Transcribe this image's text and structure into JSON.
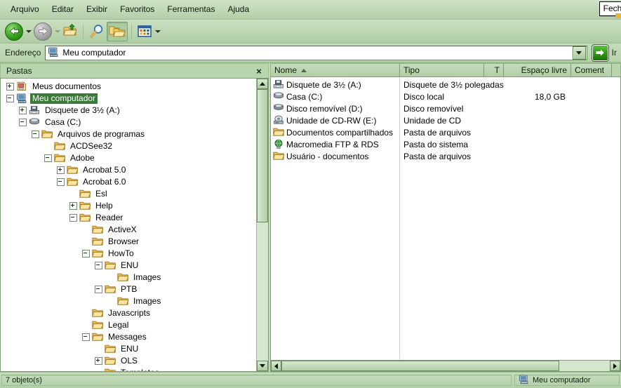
{
  "window": {
    "tooltip": "Fechar"
  },
  "menu": {
    "items": [
      {
        "label": "Arquivo"
      },
      {
        "label": "Editar"
      },
      {
        "label": "Exibir"
      },
      {
        "label": "Favoritos"
      },
      {
        "label": "Ferramentas"
      },
      {
        "label": "Ajuda"
      }
    ]
  },
  "toolbar": {
    "back": "Voltar",
    "forward": "Avançar",
    "up": "Acima",
    "search": "Pesquisar",
    "folders": "Pastas",
    "views": "Modos de exibição"
  },
  "address": {
    "label": "Endereço",
    "value": "Meu computador",
    "go_label": "Ir"
  },
  "tree": {
    "header": "Pastas",
    "close_label": "×",
    "items": [
      {
        "label": "Meus documentos",
        "indent": 0,
        "toggle": "plus",
        "icon": "my-documents-icon",
        "selected": false
      },
      {
        "label": "Meu computador",
        "indent": 0,
        "toggle": "minus",
        "icon": "my-computer-icon",
        "selected": true
      },
      {
        "label": "Disquete de 3½ (A:)",
        "indent": 1,
        "toggle": "plus",
        "icon": "floppy-icon",
        "selected": false
      },
      {
        "label": "Casa (C:)",
        "indent": 1,
        "toggle": "minus",
        "icon": "harddisk-icon",
        "selected": false
      },
      {
        "label": "Arquivos de programas",
        "indent": 2,
        "toggle": "minus",
        "icon": "folder-icon",
        "selected": false
      },
      {
        "label": "ACDSee32",
        "indent": 3,
        "toggle": "none",
        "icon": "folder-icon",
        "selected": false
      },
      {
        "label": "Adobe",
        "indent": 3,
        "toggle": "minus",
        "icon": "folder-icon",
        "selected": false
      },
      {
        "label": "Acrobat 5.0",
        "indent": 4,
        "toggle": "plus",
        "icon": "folder-icon",
        "selected": false
      },
      {
        "label": "Acrobat 6.0",
        "indent": 4,
        "toggle": "minus",
        "icon": "folder-icon",
        "selected": false
      },
      {
        "label": "Esl",
        "indent": 5,
        "toggle": "none",
        "icon": "folder-icon",
        "selected": false
      },
      {
        "label": "Help",
        "indent": 5,
        "toggle": "plus",
        "icon": "folder-icon",
        "selected": false
      },
      {
        "label": "Reader",
        "indent": 5,
        "toggle": "minus",
        "icon": "folder-icon",
        "selected": false
      },
      {
        "label": "ActiveX",
        "indent": 6,
        "toggle": "none",
        "icon": "folder-icon",
        "selected": false
      },
      {
        "label": "Browser",
        "indent": 6,
        "toggle": "none",
        "icon": "folder-icon",
        "selected": false
      },
      {
        "label": "HowTo",
        "indent": 6,
        "toggle": "minus",
        "icon": "folder-icon",
        "selected": false
      },
      {
        "label": "ENU",
        "indent": 7,
        "toggle": "minus",
        "icon": "folder-icon",
        "selected": false
      },
      {
        "label": "Images",
        "indent": 8,
        "toggle": "none",
        "icon": "folder-icon",
        "selected": false
      },
      {
        "label": "PTB",
        "indent": 7,
        "toggle": "minus",
        "icon": "folder-icon",
        "selected": false
      },
      {
        "label": "Images",
        "indent": 8,
        "toggle": "none",
        "icon": "folder-icon",
        "selected": false
      },
      {
        "label": "Javascripts",
        "indent": 6,
        "toggle": "none",
        "icon": "folder-icon",
        "selected": false
      },
      {
        "label": "Legal",
        "indent": 6,
        "toggle": "none",
        "icon": "folder-icon",
        "selected": false
      },
      {
        "label": "Messages",
        "indent": 6,
        "toggle": "minus",
        "icon": "folder-icon",
        "selected": false
      },
      {
        "label": "ENU",
        "indent": 7,
        "toggle": "none",
        "icon": "folder-icon",
        "selected": false
      },
      {
        "label": "OLS",
        "indent": 7,
        "toggle": "plus",
        "icon": "folder-icon",
        "selected": false
      },
      {
        "label": "Templates",
        "indent": 7,
        "toggle": "none",
        "icon": "folder-icon",
        "selected": false
      }
    ]
  },
  "list": {
    "columns": [
      {
        "label": "Nome",
        "align": "left",
        "sorted": "asc"
      },
      {
        "label": "Tipo",
        "align": "left",
        "sorted": "none"
      },
      {
        "label": "T",
        "align": "right",
        "sorted": "none"
      },
      {
        "label": "Espaço livre",
        "align": "right",
        "sorted": "none"
      },
      {
        "label": "Coment",
        "align": "left",
        "sorted": "none"
      }
    ],
    "rows": [
      {
        "name": "Disquete de 3½ (A:)",
        "type": "Disquete de 3½ polegadas",
        "total": "",
        "free": "",
        "comment": "",
        "icon": "floppy-icon"
      },
      {
        "name": "Casa (C:)",
        "type": "Disco local",
        "total": "",
        "free": "18,0 GB",
        "comment": "",
        "icon": "harddisk-icon"
      },
      {
        "name": "Disco removível (D:)",
        "type": "Disco removível",
        "total": "",
        "free": "",
        "comment": "",
        "icon": "removable-icon"
      },
      {
        "name": "Unidade de CD-RW (E:)",
        "type": "Unidade de CD",
        "total": "",
        "free": "",
        "comment": "",
        "icon": "cdrom-icon"
      },
      {
        "name": "Documentos compartilhados",
        "type": "Pasta de arquivos",
        "total": "",
        "free": "",
        "comment": "",
        "icon": "folder-icon"
      },
      {
        "name": "Macromedia FTP & RDS",
        "type": "Pasta do sistema",
        "total": "",
        "free": "",
        "comment": "",
        "icon": "globe-icon"
      },
      {
        "name": "Usuário - documentos",
        "type": "Pasta de arquivos",
        "total": "",
        "free": "",
        "comment": "",
        "icon": "folder-icon"
      }
    ]
  },
  "status": {
    "object_count": "7 objeto(s)",
    "location": "Meu computador"
  },
  "colors": {
    "chrome": "#c3dcba",
    "selection": "#3c7a3a",
    "accent_green": "#2f9a14",
    "border": "#7d9d74"
  }
}
